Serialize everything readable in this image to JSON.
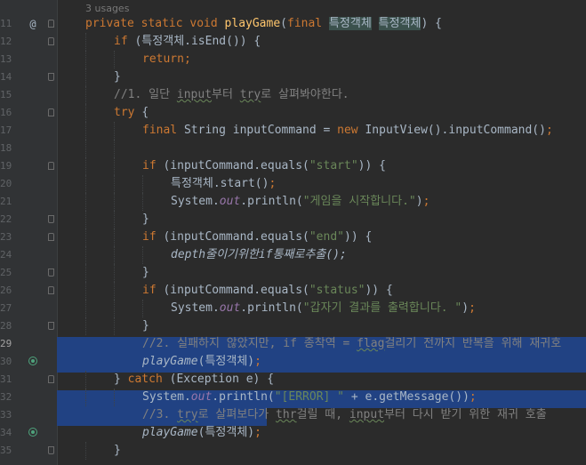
{
  "editor": {
    "usages_label": "3 usages",
    "lines": [
      {
        "n": "11",
        "text": "private static void playGame(final 특정객체 특정객체) {"
      },
      {
        "n": "12",
        "text": "if (특정객체.isEnd()) {"
      },
      {
        "n": "13",
        "text": "return;"
      },
      {
        "n": "14",
        "text": "}"
      },
      {
        "n": "15",
        "text": "//1. 일단 input부터 try로 살펴봐야한다."
      },
      {
        "n": "16",
        "text": "try {"
      },
      {
        "n": "17",
        "text": "final String inputCommand = new InputView().inputCommand();"
      },
      {
        "n": "18",
        "text": ""
      },
      {
        "n": "19",
        "text": "if (inputCommand.equals(\"start\")) {"
      },
      {
        "n": "20",
        "text": "특정객체.start();"
      },
      {
        "n": "21",
        "text": "System.out.println(\"게임을 시작합니다.\");"
      },
      {
        "n": "22",
        "text": "}"
      },
      {
        "n": "23",
        "text": "if (inputCommand.equals(\"end\")) {"
      },
      {
        "n": "24",
        "text": "depth줄이기위한if통째로추출();"
      },
      {
        "n": "25",
        "text": "}"
      },
      {
        "n": "26",
        "text": "if (inputCommand.equals(\"status\")) {"
      },
      {
        "n": "27",
        "text": "System.out.println(\"갑자기 결과를 출력합니다. \");"
      },
      {
        "n": "28",
        "text": "}"
      },
      {
        "n": "29",
        "text": "//2. 실패하지 않았지만, if 종착역 = flag걸리기 전까지 반복을 위해 재귀호"
      },
      {
        "n": "30",
        "text": "playGame(특정객체);"
      },
      {
        "n": "31",
        "text": "} catch (Exception e) {"
      },
      {
        "n": "32",
        "text": "System.out.println(\"[ERROR] \" + e.getMessage());"
      },
      {
        "n": "33",
        "text": "//3. try로 살펴보다가 thr걸릴 때, input부터 다시 받기 위한 재귀 호출"
      },
      {
        "n": "34",
        "text": "playGame(특정객체);"
      },
      {
        "n": "35",
        "text": "}"
      }
    ]
  }
}
